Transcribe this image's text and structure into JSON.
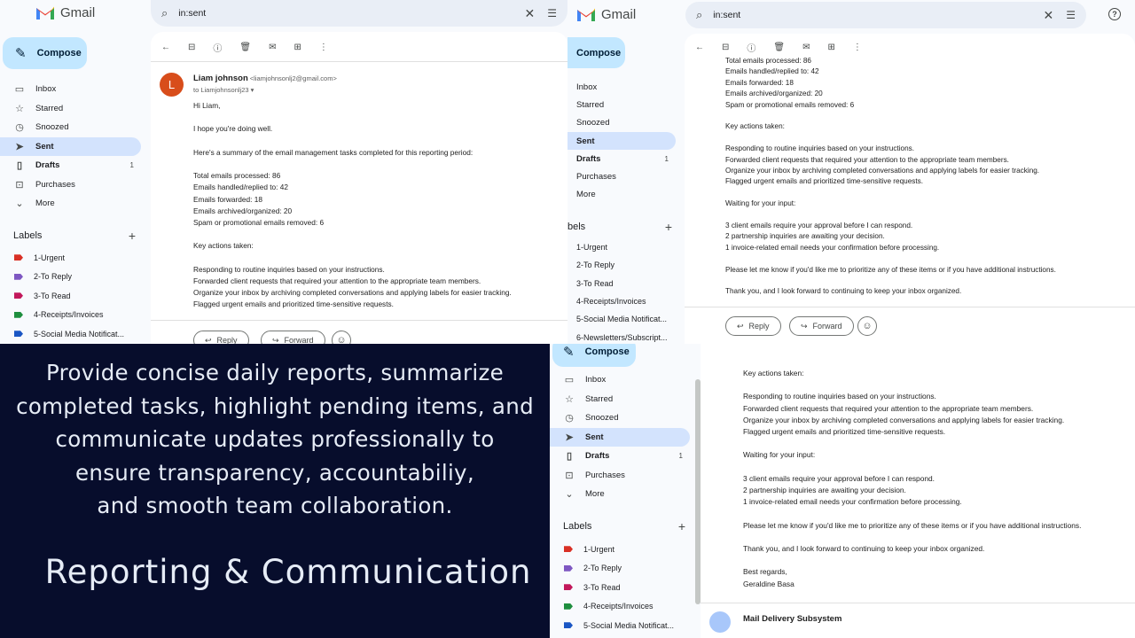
{
  "app": {
    "name": "Gmail"
  },
  "search": {
    "query": "in:sent"
  },
  "compose_label": "Compose",
  "nav_p1": [
    {
      "label": "Inbox",
      "icon": "inbox-icon",
      "glyph": "▭"
    },
    {
      "label": "Starred",
      "icon": "star-icon",
      "glyph": "☆"
    },
    {
      "label": "Snoozed",
      "icon": "clock-icon",
      "glyph": "◷"
    },
    {
      "label": "Sent",
      "icon": "send-icon",
      "glyph": "➤",
      "active": true
    },
    {
      "label": "Drafts",
      "icon": "draft-icon",
      "glyph": "▯",
      "count": "1",
      "bold": true
    },
    {
      "label": "Purchases",
      "icon": "bag-icon",
      "glyph": "⊡"
    },
    {
      "label": "More",
      "icon": "chevron-down-icon",
      "glyph": "⌄"
    }
  ],
  "nav_p2": [
    {
      "label": "Inbox"
    },
    {
      "label": "Starred"
    },
    {
      "label": "Snoozed"
    },
    {
      "label": "Sent",
      "active": true
    },
    {
      "label": "Drafts",
      "count": "1",
      "bold": true
    },
    {
      "label": "Purchases"
    },
    {
      "label": "More"
    }
  ],
  "labels_title": "Labels",
  "labels_title_cut": "bels",
  "labels_p1": [
    {
      "label": "1-Urgent",
      "color": "#d93025"
    },
    {
      "label": "2-To Reply",
      "color": "#7e57c2"
    },
    {
      "label": "3-To Read",
      "color": "#c2185b"
    },
    {
      "label": "4-Receipts/Invoices",
      "color": "#1e8e3e"
    },
    {
      "label": "5-Social Media Notificat...",
      "color": "#1a56c4"
    }
  ],
  "labels_p2": [
    {
      "label": "1-Urgent"
    },
    {
      "label": "2-To Reply"
    },
    {
      "label": "3-To Read"
    },
    {
      "label": "4-Receipts/Invoices"
    },
    {
      "label": "5-Social Media Notificat..."
    },
    {
      "label": "6-Newsletters/Subscript..."
    }
  ],
  "email": {
    "sender_name": "Liam johnson",
    "sender_addr": "<liamjohnsonlj2@gmail.com>",
    "to": "to Liamjohnsonlj23 ▾",
    "avatar": "L",
    "lines_p1": [
      "Hi Liam,",
      "",
      "I hope you're doing well.",
      "",
      "Here's a summary of the email management tasks completed for this reporting period:",
      "",
      "Total emails processed: 86",
      "Emails handled/replied to: 42",
      "Emails forwarded: 18",
      "Emails archived/organized: 20",
      "Spam or promotional emails removed: 6",
      "",
      "Key actions taken:",
      "",
      "Responding to routine inquiries based on your instructions.",
      "Forwarded client requests that required your attention to the appropriate team members.",
      "Organize your inbox by archiving completed conversations and applying labels for easier tracking.",
      "Flagged urgent emails and prioritized time-sensitive requests."
    ],
    "lines_p2": [
      "Total emails processed: 86",
      "Emails handled/replied to: 42",
      "Emails forwarded: 18",
      "Emails archived/organized: 20",
      "Spam or promotional emails removed: 6",
      "",
      "Key actions taken:",
      "",
      "Responding to routine inquiries based on your instructions.",
      "Forwarded client requests that required your attention to the appropriate team members.",
      "Organize your inbox by archiving completed conversations and applying labels for easier tracking.",
      "Flagged urgent emails and prioritized time-sensitive requests.",
      "",
      "Waiting for your input:",
      "",
      "3 client emails require your approval before I can respond.",
      "2 partnership inquiries are awaiting your decision.",
      "1 invoice-related email needs your confirmation before processing.",
      "",
      "Please let me know if you'd like me to prioritize any of these items or if you have additional instructions.",
      "",
      "Thank you, and I look forward to continuing to keep your inbox organized."
    ],
    "lines_p3": [
      "Key actions taken:",
      "",
      "Responding to routine inquiries based on your instructions.",
      "Forwarded client requests that required your attention to the appropriate team members.",
      "Organize your inbox by archiving completed conversations and applying labels for easier tracking.",
      "Flagged urgent emails and prioritized time-sensitive requests.",
      "",
      "Waiting for your input:",
      "",
      "3 client emails require your approval before I can respond.",
      "2 partnership inquiries are awaiting your decision.",
      "1 invoice-related email needs your confirmation before processing.",
      "",
      "Please let me know if you'd like me to prioritize any of these items or if you have additional instructions.",
      "",
      "Thank you, and I look forward to continuing to keep your inbox organized.",
      "",
      "Best regards,",
      "Geraldine Basa"
    ],
    "reply_label": "Reply",
    "forward_label": "Forward",
    "next_sender": "Mail Delivery Subsystem"
  },
  "banner": {
    "description_lines": [
      "Provide concise daily reports, summarize",
      "completed tasks, highlight pending items, and",
      "communicate updates professionally to",
      "ensure transparency, accountabiliy,",
      "and smooth team collaboration."
    ],
    "title": "Reporting & Communication"
  },
  "colors": {
    "banner_bg": "#070d2c",
    "compose_bg": "#c2e7ff",
    "active_nav": "#d3e3fd"
  }
}
